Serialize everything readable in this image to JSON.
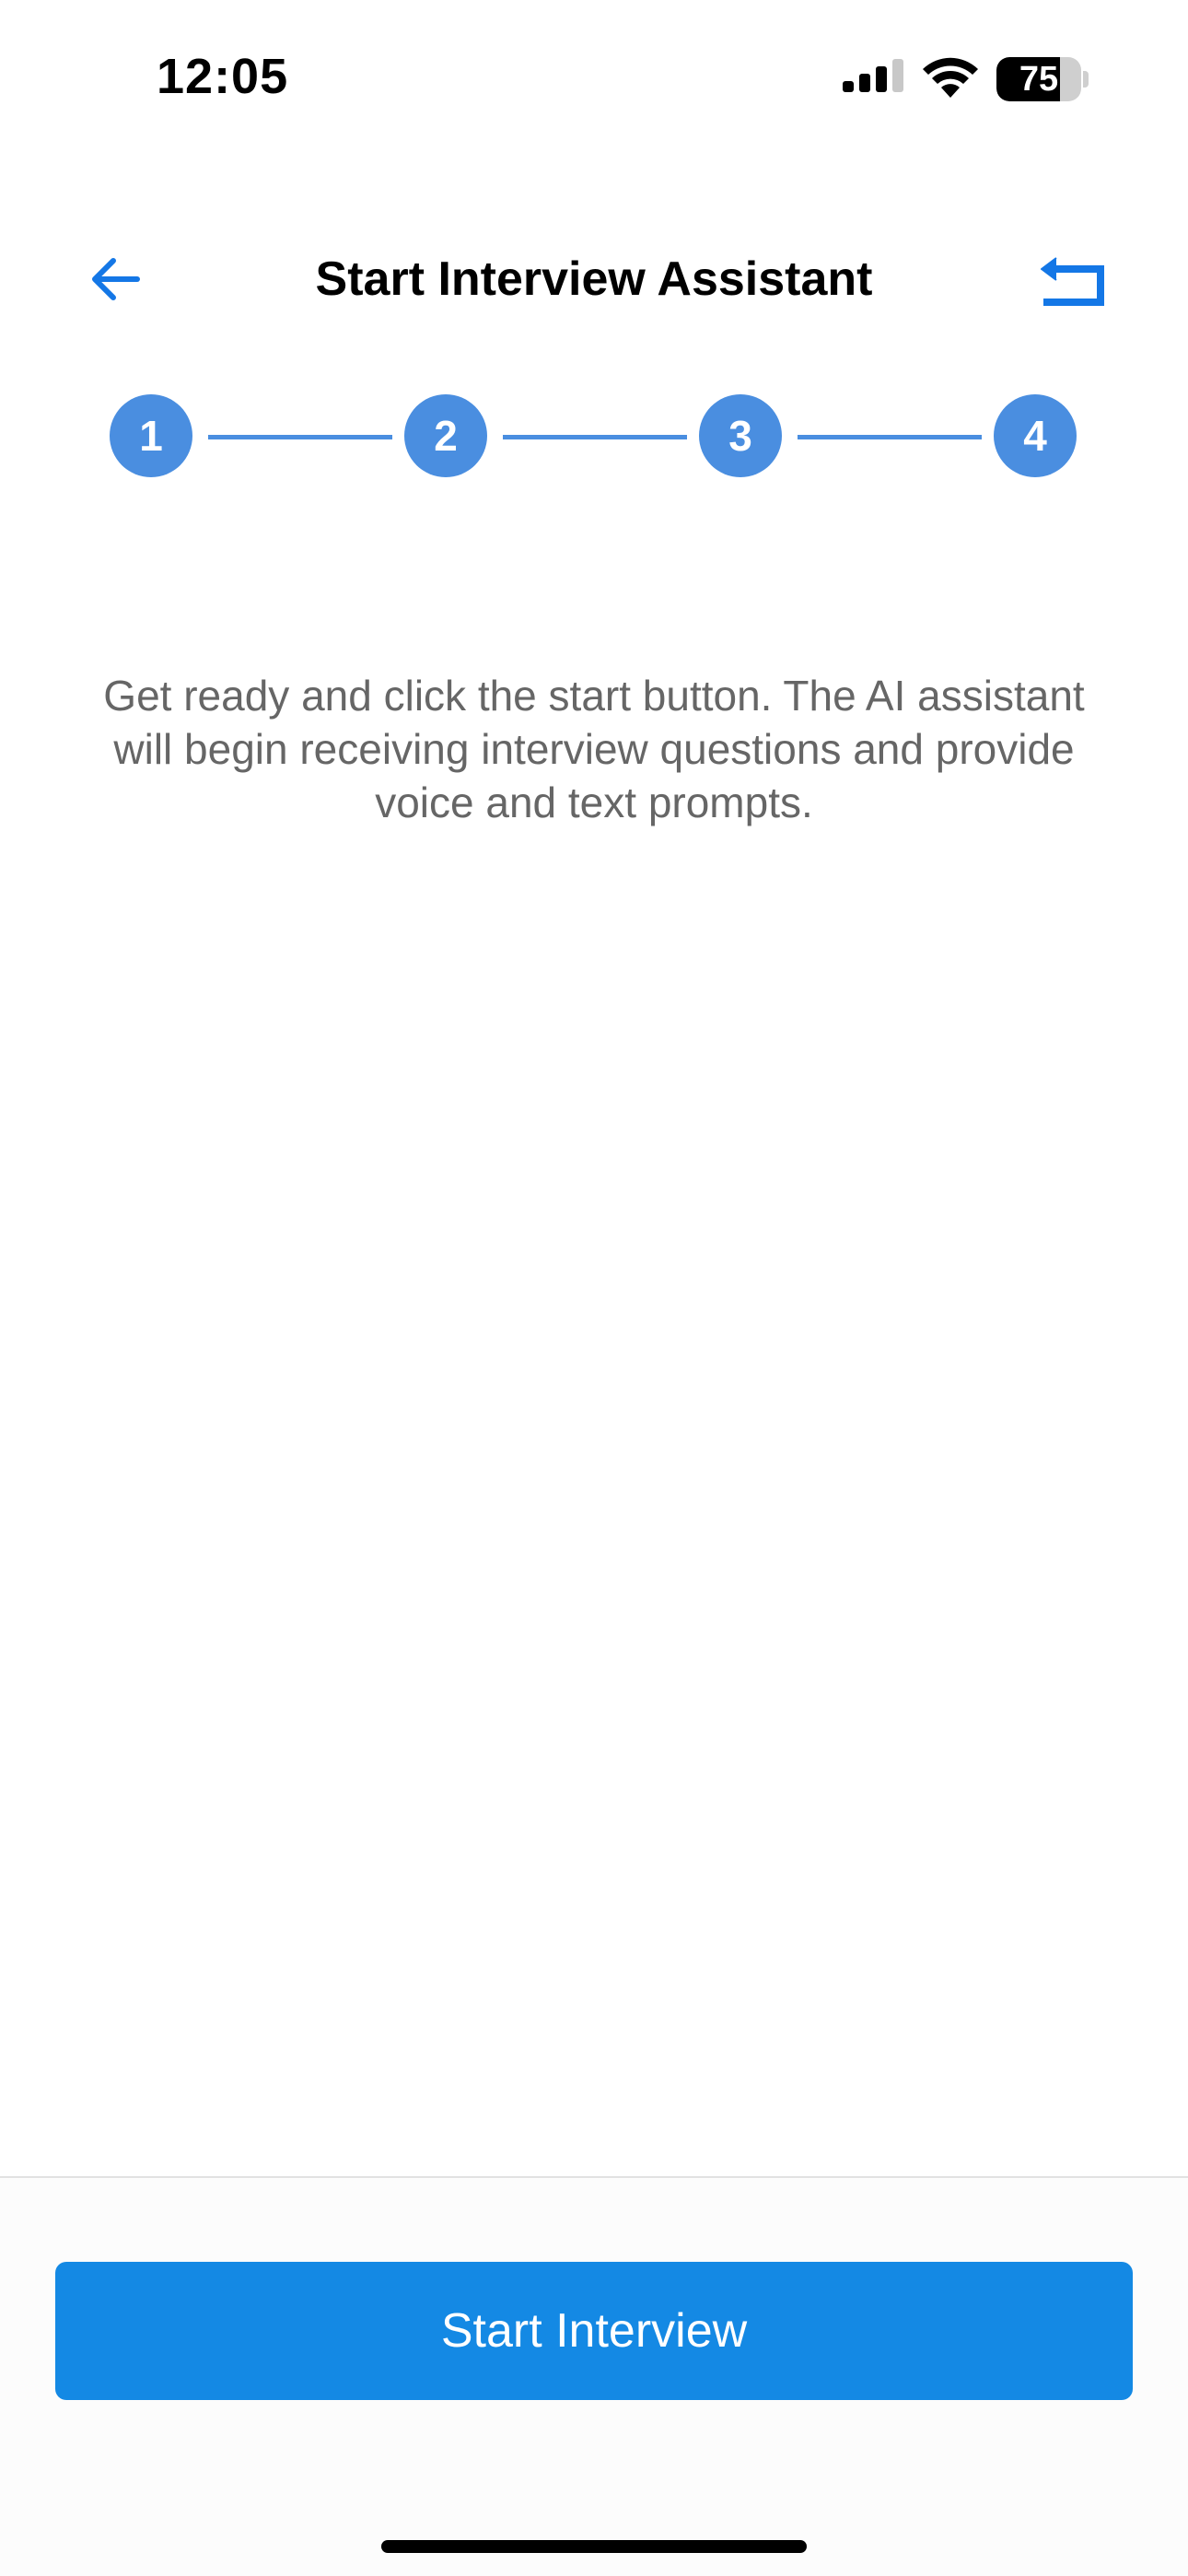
{
  "status_bar": {
    "time": "12:05",
    "battery_level": "75",
    "battery_fraction": 0.75
  },
  "nav": {
    "title": "Start Interview Assistant",
    "back_icon": "arrow-left-icon",
    "action_icon": "return-icon"
  },
  "stepper": {
    "steps": [
      "1",
      "2",
      "3",
      "4"
    ],
    "active_color": "#4a8ee0"
  },
  "description": "Get ready and click the start button. The AI assistant will begin receiving interview questions and provide voice and text prompts.",
  "primary_button": {
    "label": "Start Interview",
    "color": "#1489e4"
  },
  "colors": {
    "accent": "#1477e6",
    "step": "#4a8ee0",
    "button": "#1489e4",
    "description_text": "#666666"
  }
}
